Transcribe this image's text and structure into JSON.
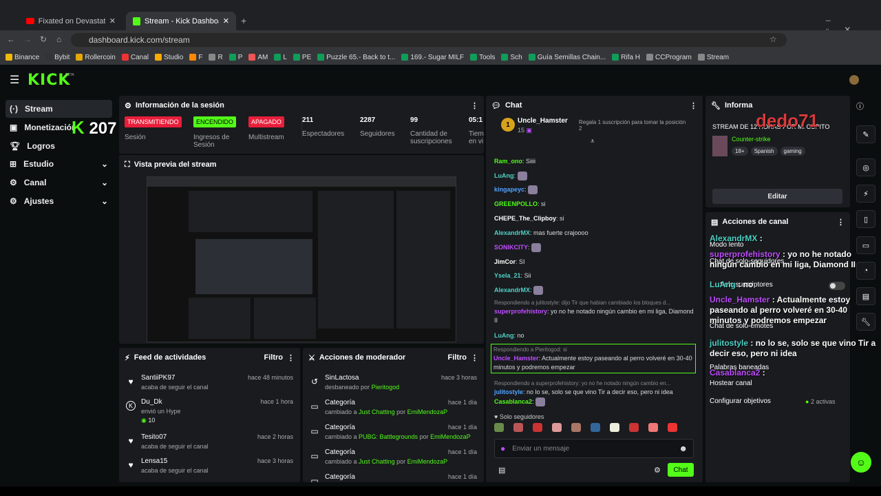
{
  "browser": {
    "tabs": [
      {
        "title": "Fixated on Devastation - Yo"
      },
      {
        "title": "Stream - Kick Dashboard"
      }
    ],
    "url": "dashboard.kick.com/stream",
    "bookmarks": [
      "Binance",
      "Bybit",
      "Rollercoin",
      "Canal",
      "Studio",
      "F",
      "R",
      "P",
      "AM",
      "L",
      "PE",
      "Puzzle 65.- Back to t...",
      "169.- Sugar MILF",
      "Tools",
      "Sch",
      "Guía Semillas Chain...",
      "Rifa H",
      "CCProgram",
      "Stream"
    ]
  },
  "brand": {
    "logo": "KICK",
    "beta": "BETA",
    "accent": "#53fc18"
  },
  "sidebar": {
    "items": [
      {
        "label": "Stream"
      },
      {
        "label": "Monetización"
      },
      {
        "label": "Logros"
      },
      {
        "label": "Estudio"
      },
      {
        "label": "Canal"
      },
      {
        "label": "Ajustes"
      }
    ],
    "overlay_count": "207"
  },
  "session": {
    "title": "Información de la sesión",
    "stats": [
      {
        "badge": "TRANSMITIENDO",
        "label": "Sesión",
        "color": "#e91e3b"
      },
      {
        "badge": "ENCENDIDO",
        "label": "Ingresos de Sesión",
        "color": "#53fc18"
      },
      {
        "badge": "APAGADO",
        "label": "Multistream",
        "color": "#e91e3b"
      },
      {
        "value": "211",
        "label": "Espectadores"
      },
      {
        "value": "2287",
        "label": "Seguidores"
      },
      {
        "value": "99",
        "label": "Cantidad de suscripciones"
      },
      {
        "value": "05:1",
        "label": "Tiem en vi"
      }
    ]
  },
  "preview": {
    "title": "Vista previa del stream"
  },
  "activity": {
    "title": "Feed de actividades",
    "filter": "Filtro",
    "items": [
      {
        "icon": "heart-icon",
        "name": "SantiiPK97",
        "sub": "acaba de seguir el canal",
        "time": "hace 48 minutos"
      },
      {
        "icon": "kick-icon",
        "name": "Du_Dk",
        "sub": "envió un Hype",
        "extra": "10",
        "time": "hace 1 hora"
      },
      {
        "icon": "heart-icon",
        "name": "Tesito07",
        "sub": "acaba de seguir el canal",
        "time": "hace 2 horas"
      },
      {
        "icon": "heart-icon",
        "name": "Lensa15",
        "sub": "acaba de seguir el canal",
        "time": "hace 3 horas"
      }
    ]
  },
  "modactions": {
    "title": "Acciones de moderador",
    "filter": "Filtro",
    "items": [
      {
        "name": "SinLactosa",
        "sub": "desbaneado por",
        "who": "Pieritogod",
        "time": "hace 3 horas"
      },
      {
        "name": "Categoría",
        "sub": "cambiado a",
        "cat": "Just Chatting",
        "who": "EmiMendozaP",
        "time": "hace 1 día"
      },
      {
        "name": "Categoría",
        "sub": "cambiado a",
        "cat": "PUBG: Battlegrounds",
        "who": "EmiMendozaP",
        "time": "hace 1 día"
      },
      {
        "name": "Categoría",
        "sub": "cambiado a",
        "cat": "Just Chatting",
        "who": "EmiMendozaP",
        "time": "hace 1 día"
      },
      {
        "name": "Categoría",
        "sub": "",
        "time": "hace 1 día"
      }
    ],
    "por": "por"
  },
  "chat": {
    "title": "Chat",
    "pinned_user": "Uncle_Hamster",
    "pinned_count": "15",
    "pinned_rank": "1",
    "gift_text": "Regala 1 suscripción para tomar la posición 2",
    "messages": [
      {
        "user": "Ram_ono",
        "color": "#53fc18",
        "text": "Siiii"
      },
      {
        "user": "LuAng",
        "color": "#4fd1c5",
        "text": ""
      },
      {
        "user": "kingapeyc",
        "color": "#4fa3ff",
        "text": ""
      },
      {
        "user": "GREENPOLLO",
        "color": "#53fc18",
        "text": "si"
      },
      {
        "user": "CHEPE_The_Clipboy",
        "color": "#fff",
        "text": "si"
      },
      {
        "user": "AlexandrMX",
        "color": "#4fd1c5",
        "text": "mas fuerte crajoooo"
      },
      {
        "user": "SONIKCITY",
        "color": "#c04cff",
        "text": ""
      },
      {
        "user": "JimCor",
        "color": "#fff",
        "text": "SI"
      },
      {
        "user": "Ysela_21",
        "color": "#4fd1c5",
        "text": "Sii"
      },
      {
        "user": "AlexandrMX",
        "color": "#4fd1c5",
        "text": ""
      },
      {
        "reply": "Respondiendo a julitostyle: dijo Tir que habian cambiado los bloques d...",
        "user": "superprofehistory",
        "color": "#c04cff",
        "text": "yo no he notado ningún cambio en mi liga, Diamond II"
      },
      {
        "user": "LuAng",
        "color": "#4fd1c5",
        "text": "no"
      },
      {
        "reply": "Respondiendo a Pieritogod: si",
        "user": "Uncle_Hamster",
        "color": "#c04cff",
        "text": "Actualmente estoy paseando al perro volveré en 30-40 minutos y podremos empezar"
      },
      {
        "reply": "Respondiendo a superprofehistory: yo no he notado ningún cambio en...",
        "user": "julitostyle",
        "color": "#4fa3ff",
        "text": "no lo se, solo se que vino Tir a decir eso, pero ni idea"
      },
      {
        "user": "Casablanca2",
        "color": "#53fc18",
        "text": ""
      }
    ],
    "followers_only": "Solo seguidores",
    "input_placeholder": "Enviar un mensaje",
    "send_label": "Chat"
  },
  "info": {
    "title": "Informa",
    "stream_title": "STREAM DE 12 HORAS POR MI CUPITO",
    "category": "Counter-strike",
    "tags": [
      "18+",
      "Spanish",
      "gaming"
    ],
    "edit_label": "Editar",
    "overlay_name": "dedo71"
  },
  "channel_actions": {
    "title": "Acciones de canal",
    "rows": [
      "Modo lento",
      "Chat de solo-seguidores",
      "Solo suscriptores",
      "Chat de solo-emotes",
      "Palabras baneadas",
      "Hostear canal",
      "Configurar objetivos"
    ],
    "goals_status": "2 activas"
  },
  "overlay_chat": [
    {
      "user": "AlexandrMX",
      "text": ""
    },
    {
      "user": "superprofehistory",
      "text": "yo no he notado ningún cambio en mi liga, Diamond II"
    },
    {
      "user": "LuAng",
      "text": "no"
    },
    {
      "user": "Uncle_Hamster",
      "text": "Actualmente estoy paseando al perro volveré en 30-40 minutos y podremos empezar"
    },
    {
      "user": "julitostyle",
      "text": "no lo se, solo se que vino Tir a decir eso, pero ni idea"
    },
    {
      "user": "Casablanca2",
      "text": ""
    }
  ]
}
